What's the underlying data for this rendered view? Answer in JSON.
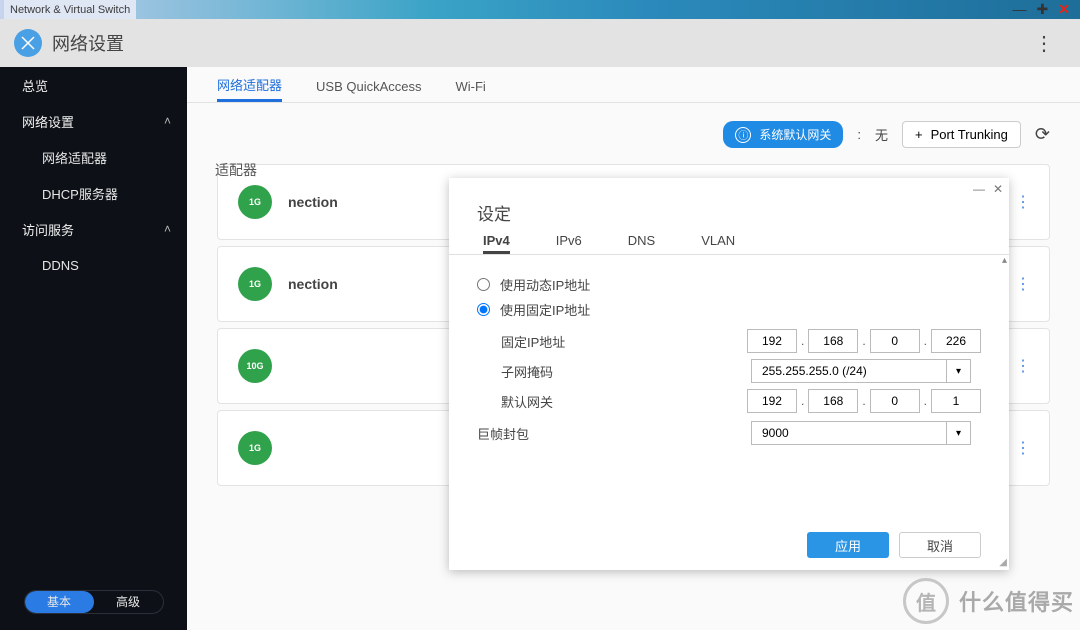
{
  "window": {
    "title": "Network & Virtual Switch"
  },
  "header": {
    "title": "网络设置"
  },
  "sidebar": {
    "items": [
      {
        "label": "总览"
      },
      {
        "label": "网络设置"
      },
      {
        "label": "网络适配器"
      },
      {
        "label": "DHCP服务器"
      },
      {
        "label": "访问服务"
      },
      {
        "label": "DDNS"
      }
    ],
    "mode_basic": "基本",
    "mode_advanced": "高级"
  },
  "tabs": [
    {
      "label": "网络适配器"
    },
    {
      "label": "USB QuickAccess"
    },
    {
      "label": "Wi-Fi"
    }
  ],
  "toolbar": {
    "gateway_label": "系统默认网关",
    "gateway_value": "无",
    "port_trunking": "Port Trunking"
  },
  "adapter_section_title": "适配器",
  "cards": [
    {
      "speed": "1G",
      "suffix": "nection",
      "color": "#31a24c"
    },
    {
      "speed": "1G",
      "suffix": "nection",
      "color": "#31a24c"
    },
    {
      "speed": "10G",
      "suffix": "",
      "color": "#31a24c"
    },
    {
      "speed": "1G",
      "suffix": "",
      "color": "#31a24c"
    }
  ],
  "modal": {
    "title": "设定",
    "tabs": {
      "ipv4": "IPv4",
      "ipv6": "IPv6",
      "dns": "DNS",
      "vlan": "VLAN"
    },
    "radio_dynamic": "使用动态IP地址",
    "radio_static": "使用固定IP地址",
    "labels": {
      "fixed_ip": "固定IP地址",
      "subnet": "子网掩码",
      "gateway": "默认网关",
      "jumbo": "巨帧封包"
    },
    "ip": {
      "a": "192",
      "b": "168",
      "c": "0",
      "d": "226"
    },
    "subnet": "255.255.255.0 (/24)",
    "gw": {
      "a": "192",
      "b": "168",
      "c": "0",
      "d": "1"
    },
    "jumbo": "9000",
    "apply": "应用",
    "cancel": "取消"
  },
  "watermark": {
    "text": "什么值得买",
    "badge": "值"
  }
}
